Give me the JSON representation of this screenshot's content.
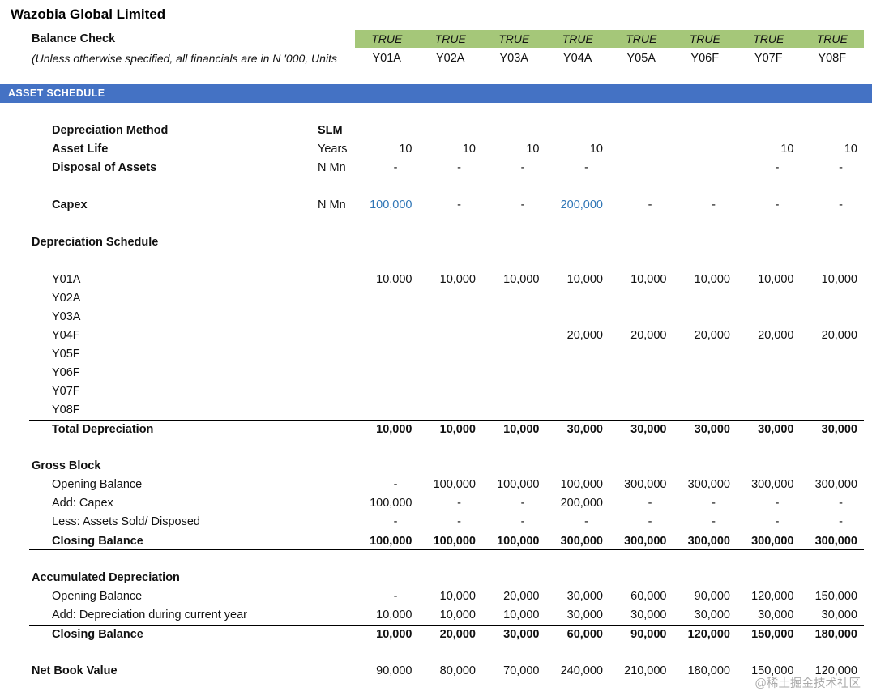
{
  "title": "Wazobia Global Limited",
  "header": {
    "balance_check_label": "Balance Check",
    "subtitle": "(Unless otherwise specified, all financials are in N '000, Units",
    "true_values": [
      "TRUE",
      "TRUE",
      "TRUE",
      "TRUE",
      "TRUE",
      "TRUE",
      "TRUE",
      "TRUE"
    ],
    "years": [
      "Y01A",
      "Y02A",
      "Y03A",
      "Y04A",
      "Y05A",
      "Y06F",
      "Y07F",
      "Y08F"
    ]
  },
  "banner": {
    "label": "ASSET SCHEDULE"
  },
  "colors": {
    "green_fill": "#a5c779",
    "banner_blue": "#4472c4",
    "input_blue": "#2e75b6"
  },
  "watermark": "@稀土掘金技术社区",
  "rows": [
    {
      "label": "Depreciation Method",
      "unit": "SLM",
      "bold": true,
      "unit_bold": true,
      "indent": 1
    },
    {
      "label": "Asset Life",
      "unit": "Years",
      "bold": true,
      "indent": 1,
      "values": [
        "10",
        "10",
        "10",
        "10",
        "",
        "",
        "10",
        "10"
      ]
    },
    {
      "label": "Disposal of Assets",
      "unit": "N Mn",
      "bold": true,
      "indent": 1,
      "values": [
        "-",
        "-",
        "-",
        "-",
        "",
        "",
        "-",
        "-"
      ]
    },
    {
      "type": "spacer"
    },
    {
      "label": "Capex",
      "unit": "N Mn",
      "bold": true,
      "indent": 1,
      "values": [
        "100,000",
        "-",
        "-",
        "200,000",
        "-",
        "-",
        "-",
        "-"
      ],
      "blue": [
        0,
        3
      ]
    },
    {
      "type": "spacer"
    },
    {
      "label": "Depreciation Schedule",
      "bold": true,
      "indent": 0
    },
    {
      "type": "spacer"
    },
    {
      "label": "Y01A",
      "indent": 1,
      "values": [
        "10,000",
        "10,000",
        "10,000",
        "10,000",
        "10,000",
        "10,000",
        "10,000",
        "10,000"
      ]
    },
    {
      "label": "Y02A",
      "indent": 1
    },
    {
      "label": "Y03A",
      "indent": 1
    },
    {
      "label": "Y04F",
      "indent": 1,
      "values": [
        "",
        "",
        "",
        "20,000",
        "20,000",
        "20,000",
        "20,000",
        "20,000"
      ]
    },
    {
      "label": "Y05F",
      "indent": 1
    },
    {
      "label": "Y06F",
      "indent": 1
    },
    {
      "label": "Y07F",
      "indent": 1
    },
    {
      "label": "Y08F",
      "indent": 1
    },
    {
      "label": "Total Depreciation",
      "indent": 1,
      "bold": true,
      "values_bold": true,
      "border_top": true,
      "values": [
        "10,000",
        "10,000",
        "10,000",
        "30,000",
        "30,000",
        "30,000",
        "30,000",
        "30,000"
      ]
    },
    {
      "type": "spacer"
    },
    {
      "label": "Gross Block",
      "bold": true,
      "indent": 0
    },
    {
      "label": "Opening Balance",
      "indent": 1,
      "values": [
        "-",
        "100,000",
        "100,000",
        "100,000",
        "300,000",
        "300,000",
        "300,000",
        "300,000"
      ]
    },
    {
      "label": "Add: Capex",
      "indent": 1,
      "values": [
        "100,000",
        "-",
        "-",
        "200,000",
        "-",
        "-",
        "-",
        "-"
      ]
    },
    {
      "label": "Less: Assets Sold/ Disposed",
      "indent": 1,
      "values": [
        "-",
        "-",
        "-",
        "-",
        "-",
        "-",
        "-",
        "-"
      ]
    },
    {
      "label": "Closing Balance",
      "indent": 1,
      "bold": true,
      "values_bold": true,
      "border_top": true,
      "border_bottom": true,
      "values": [
        "100,000",
        "100,000",
        "100,000",
        "300,000",
        "300,000",
        "300,000",
        "300,000",
        "300,000"
      ]
    },
    {
      "type": "spacer"
    },
    {
      "label": "Accumulated Depreciation",
      "bold": true,
      "indent": 0
    },
    {
      "label": "Opening Balance",
      "indent": 1,
      "values": [
        "-",
        "10,000",
        "20,000",
        "30,000",
        "60,000",
        "90,000",
        "120,000",
        "150,000"
      ]
    },
    {
      "label": "Add: Depreciation during current year",
      "indent": 1,
      "values": [
        "10,000",
        "10,000",
        "10,000",
        "30,000",
        "30,000",
        "30,000",
        "30,000",
        "30,000"
      ]
    },
    {
      "label": "Closing Balance",
      "indent": 1,
      "bold": true,
      "values_bold": true,
      "border_top": true,
      "border_bottom": true,
      "values": [
        "10,000",
        "20,000",
        "30,000",
        "60,000",
        "90,000",
        "120,000",
        "150,000",
        "180,000"
      ]
    },
    {
      "type": "spacer"
    },
    {
      "label": "Net Book Value",
      "bold": true,
      "indent": 0,
      "values": [
        "90,000",
        "80,000",
        "70,000",
        "240,000",
        "210,000",
        "180,000",
        "150,000",
        "120,000"
      ]
    }
  ]
}
